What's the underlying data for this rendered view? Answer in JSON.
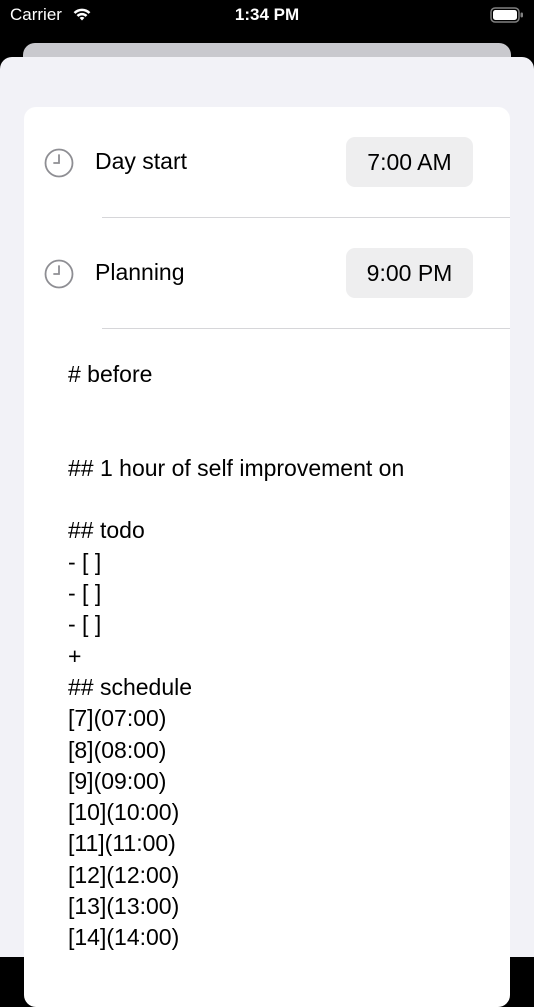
{
  "status_bar": {
    "carrier": "Carrier",
    "time": "1:34 PM"
  },
  "settings": {
    "rows": [
      {
        "label": "Day start",
        "time": "7:00 AM",
        "icon": "clock-icon"
      },
      {
        "label": "Planning",
        "time": "9:00 PM",
        "icon": "clock-icon"
      }
    ]
  },
  "notes": {
    "lines": [
      "# before",
      "",
      "",
      "## 1 hour of self improvement on",
      "",
      "## todo",
      "- [ ]",
      "- [ ]",
      "- [ ]",
      "+",
      "## schedule",
      "[7](07:00)",
      "[8](08:00)",
      "[9](09:00)",
      "[10](10:00)",
      "[11](11:00)",
      "[12](12:00)",
      "[13](13:00)",
      "[14](14:00)"
    ]
  }
}
